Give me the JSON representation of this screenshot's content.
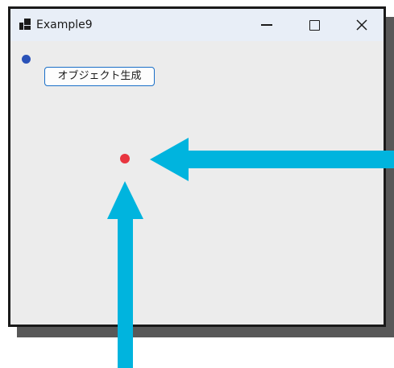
{
  "window": {
    "title": "Example9"
  },
  "client": {
    "create_button_label": "オブジェクト生成"
  },
  "colors": {
    "blue_dot": "#2a52b8",
    "red_dot": "#e8353f",
    "arrow": "#00b4de",
    "button_border": "#1a6fc8"
  },
  "icons": {
    "app": "app-window-icon",
    "minimize": "minimize-icon",
    "maximize": "maximize-icon",
    "close": "close-icon"
  }
}
